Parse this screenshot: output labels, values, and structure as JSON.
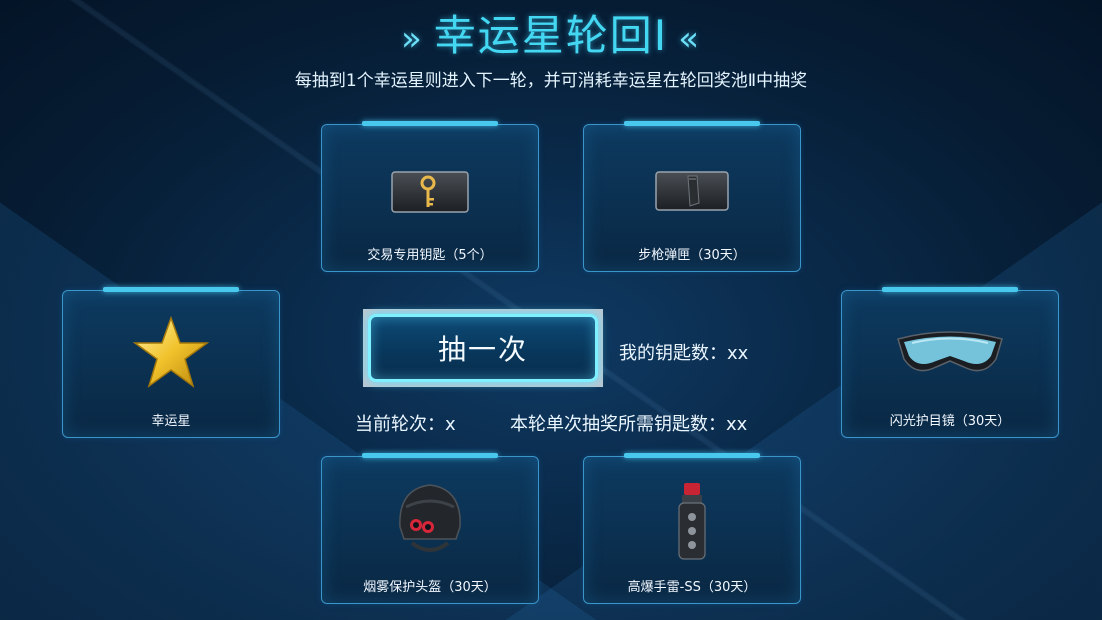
{
  "header": {
    "title": "幸运星轮回Ⅰ",
    "chevron_left": "»",
    "chevron_right": "«",
    "subtitle": "每抽到1个幸运星则进入下一轮，并可消耗幸运星在轮回奖池Ⅱ中抽奖"
  },
  "prizes": [
    {
      "label": "交易专用钥匙（5个）",
      "icon": "key-icon"
    },
    {
      "label": "步枪弹匣（30天）",
      "icon": "rifle-magazine-icon"
    },
    {
      "label": "幸运星",
      "icon": "star-icon"
    },
    {
      "label": "闪光护目镜（30天）",
      "icon": "goggles-icon"
    },
    {
      "label": "烟雾保护头盔（30天）",
      "icon": "helmet-icon"
    },
    {
      "label": "高爆手雷-SS（30天）",
      "icon": "grenade-icon"
    }
  ],
  "controls": {
    "draw_button": "抽一次",
    "my_keys": "我的钥匙数：xx",
    "current_round": "当前轮次：x",
    "keys_per_draw": "本轮单次抽奖所需钥匙数：xx"
  },
  "colors": {
    "accent": "#43d7f2",
    "card_border": "#3a95c9",
    "background": "#0a2a4a"
  }
}
